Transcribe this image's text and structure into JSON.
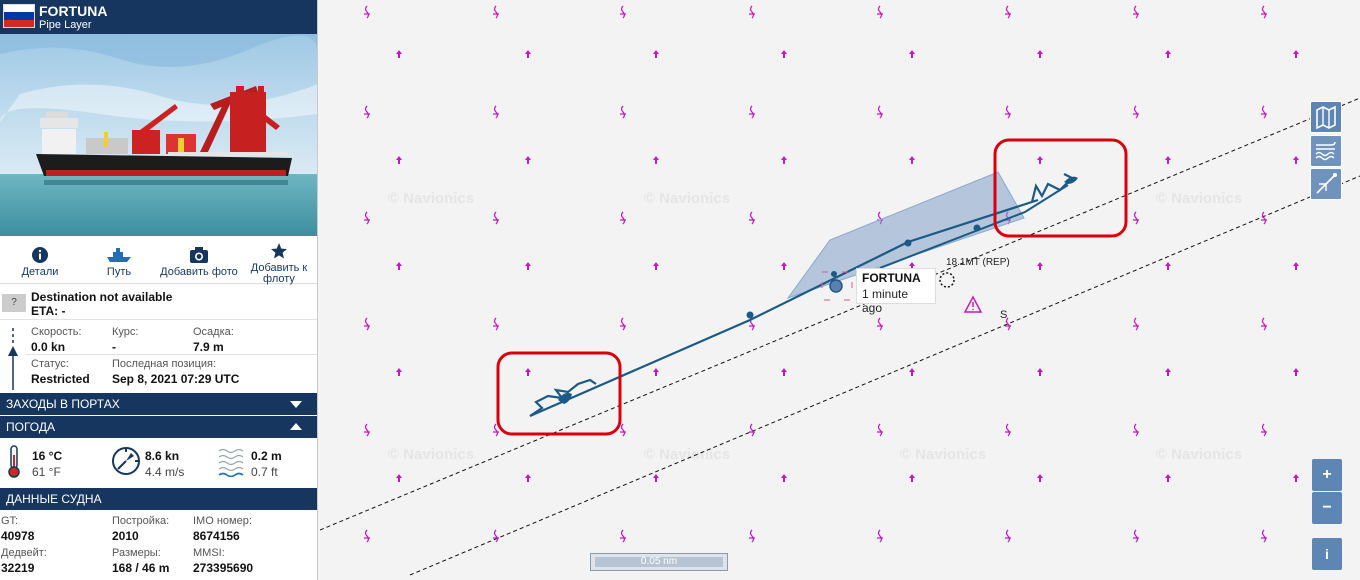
{
  "vessel": {
    "name": "FORTUNA",
    "type": "Pipe Layer",
    "flag_colors": [
      "#ffffff",
      "#0039a6",
      "#d52b1e"
    ]
  },
  "actions": {
    "details": "Детали",
    "route": "Путь",
    "add_photo": "Добавить фото",
    "add_fleet_1": "Добавить к",
    "add_fleet_2": "флоту"
  },
  "destination": {
    "icon": "?",
    "text": "Destination not available",
    "eta": "ETA: -"
  },
  "stats": {
    "speed_label": "Скорость:",
    "speed_value": "0.0 kn",
    "course_label": "Курс:",
    "course_value": "-",
    "draught_label": "Осадка:",
    "draught_value": "7.9 m",
    "status_label": "Статус:",
    "status_value": "Restricted",
    "lastpos_label": "Последная позиция:",
    "lastpos_value": "Sep 8, 2021 07:29 UTC"
  },
  "sections": {
    "port_calls": "ЗАХОДЫ В ПОРТАХ",
    "weather": "ПОГОДА",
    "vessel_data": "ДАННЫЕ СУДНА"
  },
  "weather": {
    "temp_c": "16 °C",
    "temp_f": "61 °F",
    "wind_kn": "8.6 kn",
    "wind_ms": "4.4 m/s",
    "wave_m": "0.2 m",
    "wave_ft": "0.7 ft"
  },
  "vessel_data": {
    "gt_label": "GT:",
    "gt_value": "40978",
    "built_label": "Постройка:",
    "built_value": "2010",
    "imo_label": "IMO номер:",
    "imo_value": "8674156",
    "dwt_label": "Дедвейт:",
    "dwt_value": "32219",
    "size_label": "Размеры:",
    "size_value": "168 / 46 m",
    "mmsi_label": "MMSI:",
    "mmsi_value": "273395690"
  },
  "map": {
    "tooltip_name": "FORTUNA",
    "tooltip_time": "1 minute ago",
    "rep_label": "18.1MT (REP)",
    "s_label": "S",
    "watermark": "© Navionics",
    "scale": "0.05 nm",
    "zoom_in": "+",
    "zoom_out": "−",
    "info": "i",
    "track_color": "#1b5a86",
    "highlight_color": "#d8000c"
  }
}
